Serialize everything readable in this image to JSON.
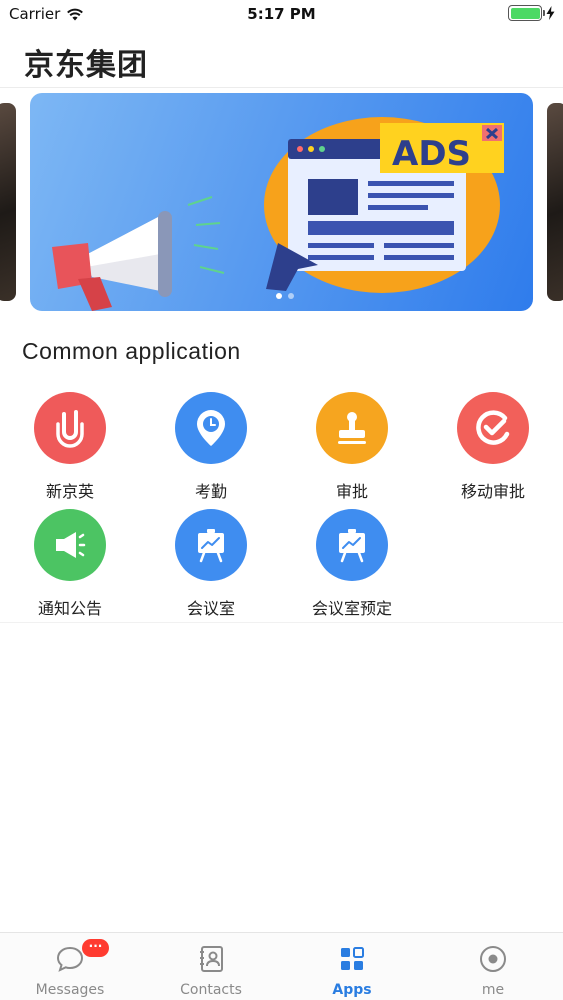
{
  "status_bar": {
    "carrier": "Carrier",
    "time": "5:17 PM",
    "battery_level": 1.0,
    "icons": [
      "wifi-icon",
      "battery-icon",
      "charging-bolt-icon"
    ]
  },
  "header": {
    "title": "京东集团"
  },
  "banner": {
    "text": "ADS",
    "page_count": 2,
    "active_page": 1,
    "colors": {
      "background": "#4c93ef",
      "accent_orange": "#f7a21b",
      "ads_yellow": "#ffd21f",
      "megaphone_red": "#e8545a"
    }
  },
  "apps_section": {
    "title": "Common application",
    "apps": [
      {
        "label": "新京英",
        "icon": "paperclip-j-icon",
        "color": "#ef5a5a"
      },
      {
        "label": "考勤",
        "icon": "location-clock-icon",
        "color": "#3f8df0"
      },
      {
        "label": "审批",
        "icon": "stamp-icon",
        "color": "#f6a51f"
      },
      {
        "label": "移动审批",
        "icon": "check-circle-icon",
        "color": "#f2605a"
      },
      {
        "label": "通知公告",
        "icon": "megaphone-icon",
        "color": "#4cc463"
      },
      {
        "label": "会议室",
        "icon": "presentation-board-icon",
        "color": "#3f8df0"
      },
      {
        "label": "会议室预定",
        "icon": "presentation-board-icon",
        "color": "#3f8df0"
      }
    ]
  },
  "tab_bar": {
    "active": "Apps",
    "accent_color": "#2a7de1",
    "tabs": [
      {
        "label": "Messages",
        "icon": "chat-bubble-icon",
        "badge": "···"
      },
      {
        "label": "Contacts",
        "icon": "contacts-book-icon"
      },
      {
        "label": "Apps",
        "icon": "apps-grid-icon"
      },
      {
        "label": "me",
        "icon": "profile-circle-icon"
      }
    ]
  }
}
